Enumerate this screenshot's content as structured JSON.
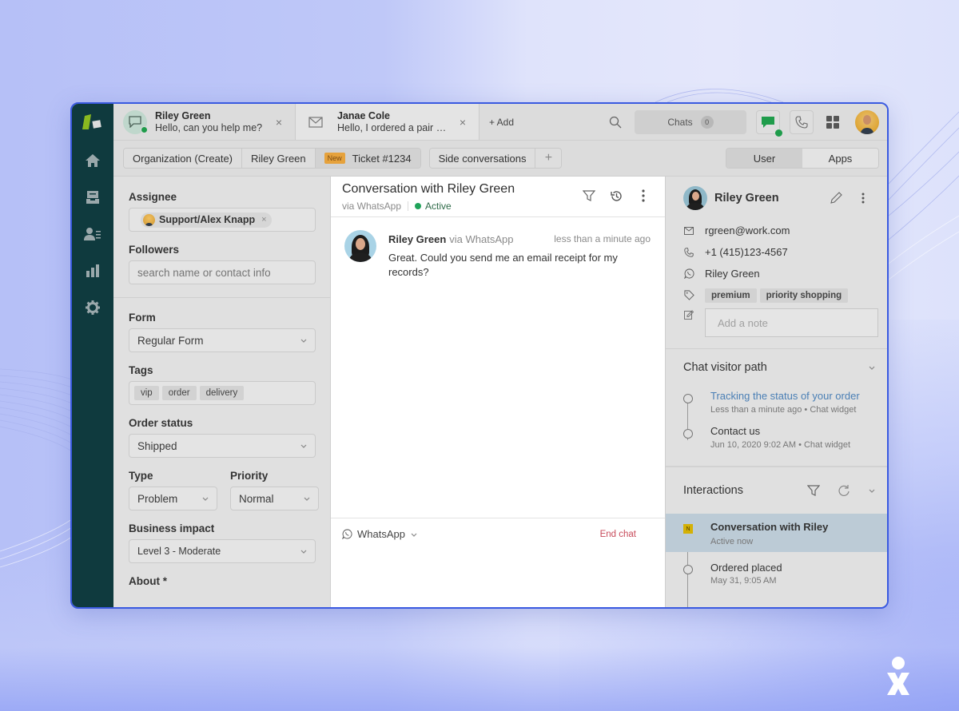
{
  "colors": {
    "window_border": "#3a5ae0",
    "rail_bg": "#0f3a3e",
    "active_green": "#1fa35a",
    "new_badge": "#e6a23c",
    "end_chat": "#c74a5a",
    "link_blue": "#4a7fb5",
    "selected_row": "#bccbd6",
    "n_badge": "#d4b106"
  },
  "rail": {
    "items": [
      {
        "name": "home",
        "icon": "home-icon"
      },
      {
        "name": "views",
        "icon": "inbox-icon"
      },
      {
        "name": "customers",
        "icon": "contacts-icon"
      },
      {
        "name": "reporting",
        "icon": "bar-chart-icon"
      },
      {
        "name": "admin",
        "icon": "gear-icon"
      }
    ]
  },
  "topbar": {
    "tabs": [
      {
        "name": "Riley Green",
        "preview": "Hello, can you help me?",
        "icon": "chat-bubble-icon",
        "close": "×"
      },
      {
        "name": "Janae Cole",
        "preview": "Hello, I ordered a pair o...",
        "icon": "mail-icon",
        "close": "×"
      }
    ],
    "add_label": "+ Add",
    "chats_label": "Chats",
    "chats_count": "0"
  },
  "subbar": {
    "crumbs": [
      "Organization (Create)",
      "Riley Green"
    ],
    "new_badge": "New",
    "ticket": "Ticket #1234",
    "side_conversations": "Side conversations",
    "side_add": "+",
    "segments": [
      "User",
      "Apps"
    ]
  },
  "ticket_fields": {
    "assignee_label": "Assignee",
    "assignee_value": "Support/Alex Knapp",
    "assignee_remove": "×",
    "followers_label": "Followers",
    "followers_placeholder": "search name or contact info",
    "form_label": "Form",
    "form_value": "Regular Form",
    "tags_label": "Tags",
    "tags": [
      "vip",
      "order",
      "delivery"
    ],
    "order_status_label": "Order status",
    "order_status_value": "Shipped",
    "type_label": "Type",
    "type_value": "Problem",
    "priority_label": "Priority",
    "priority_value": "Normal",
    "business_impact_label": "Business impact",
    "business_impact_value": "Level 3 - Moderate",
    "about_label": "About *"
  },
  "conversation": {
    "title": "Conversation with Riley Green",
    "via": "via WhatsApp",
    "status": "Active",
    "message": {
      "author": "Riley Green",
      "channel": "via WhatsApp",
      "time": "less than a minute ago",
      "text": "Great. Could you send me an email receipt for my records?"
    },
    "composer": {
      "channel": "WhatsApp",
      "end_chat": "End chat"
    }
  },
  "user_panel": {
    "name": "Riley Green",
    "email": "rgreen@work.com",
    "phone": "+1 (415)123-4567",
    "whatsapp": "Riley Green",
    "tags": [
      "premium",
      "priority shopping"
    ],
    "note_placeholder": "Add a note",
    "visitor_path": {
      "title": "Chat visitor path",
      "items": [
        {
          "title": "Tracking the status of your order",
          "meta": "Less than a minute ago • Chat widget"
        },
        {
          "title": "Contact us",
          "meta": "Jun 10, 2020 9:02 AM • Chat widget"
        }
      ]
    },
    "interactions": {
      "title": "Interactions",
      "items": [
        {
          "badge": "N",
          "title": "Conversation with Riley",
          "meta": "Active now"
        },
        {
          "title": "Ordered placed",
          "meta": "May 31, 9:05 AM"
        }
      ]
    }
  }
}
